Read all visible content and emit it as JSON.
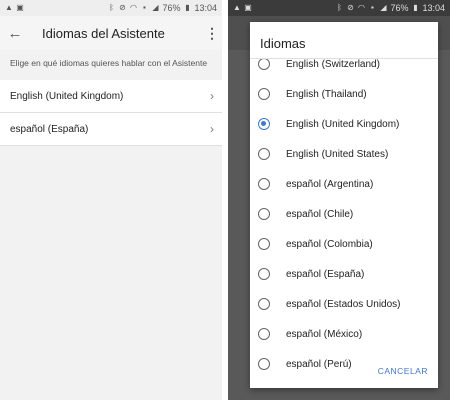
{
  "left_screen": {
    "status_bar": {
      "battery": "76%",
      "time": "13:04"
    },
    "appbar": {
      "title": "Idiomas del Asistente"
    },
    "description": "Elige en qué idiomas quieres hablar con el Asistente",
    "rows": [
      {
        "label": "English (United Kingdom)"
      },
      {
        "label": "español (España)"
      }
    ]
  },
  "right_screen": {
    "status_bar": {
      "battery": "76%",
      "time": "13:04"
    },
    "dialog": {
      "title": "Idiomas",
      "options": [
        {
          "label": "English (Switzerland)",
          "selected": false
        },
        {
          "label": "English (Thailand)",
          "selected": false
        },
        {
          "label": "English (United Kingdom)",
          "selected": true
        },
        {
          "label": "English (United States)",
          "selected": false
        },
        {
          "label": "español (Argentina)",
          "selected": false
        },
        {
          "label": "español (Chile)",
          "selected": false
        },
        {
          "label": "español (Colombia)",
          "selected": false
        },
        {
          "label": "español (España)",
          "selected": false
        },
        {
          "label": "español (Estados Unidos)",
          "selected": false
        },
        {
          "label": "español (México)",
          "selected": false
        },
        {
          "label": "español (Perú)",
          "selected": false
        }
      ],
      "cancel_label": "CANCELAR"
    }
  },
  "colors": {
    "accent": "#3c78d8",
    "scrim": "#595959"
  }
}
